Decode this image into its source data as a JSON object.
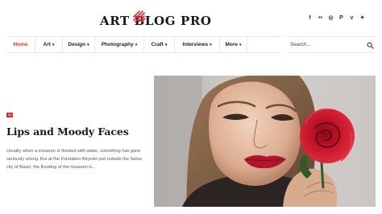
{
  "site": {
    "logo_text": "ART BLOG PRO",
    "brand_color": "#e32d2d"
  },
  "social": [
    {
      "name": "facebook-icon",
      "glyph": "f"
    },
    {
      "name": "flickr-icon",
      "glyph": "••"
    },
    {
      "name": "instagram-icon",
      "glyph": "◎"
    },
    {
      "name": "pinterest-icon",
      "glyph": "P"
    },
    {
      "name": "vimeo-icon",
      "glyph": "v"
    },
    {
      "name": "twitter-icon",
      "glyph": "✦"
    }
  ],
  "nav": {
    "items": [
      {
        "label": "Home",
        "caret": ""
      },
      {
        "label": "Art",
        "caret": "▾"
      },
      {
        "label": "Design",
        "caret": "▾"
      },
      {
        "label": "Photography",
        "caret": "▾"
      },
      {
        "label": "Craft",
        "caret": "▾"
      },
      {
        "label": "Interviews",
        "caret": "▾"
      },
      {
        "label": "More",
        "caret": "▾"
      }
    ]
  },
  "search": {
    "placeholder": "Search..."
  },
  "post": {
    "category": "Art",
    "title": "Lips and Moody Faces",
    "excerpt": "Usually when a museum is flooded with water, something has gone seriously wrong. But at the Fondation Beyeler just outside the Swiss city of Basel, the flooding of the museum is..."
  }
}
